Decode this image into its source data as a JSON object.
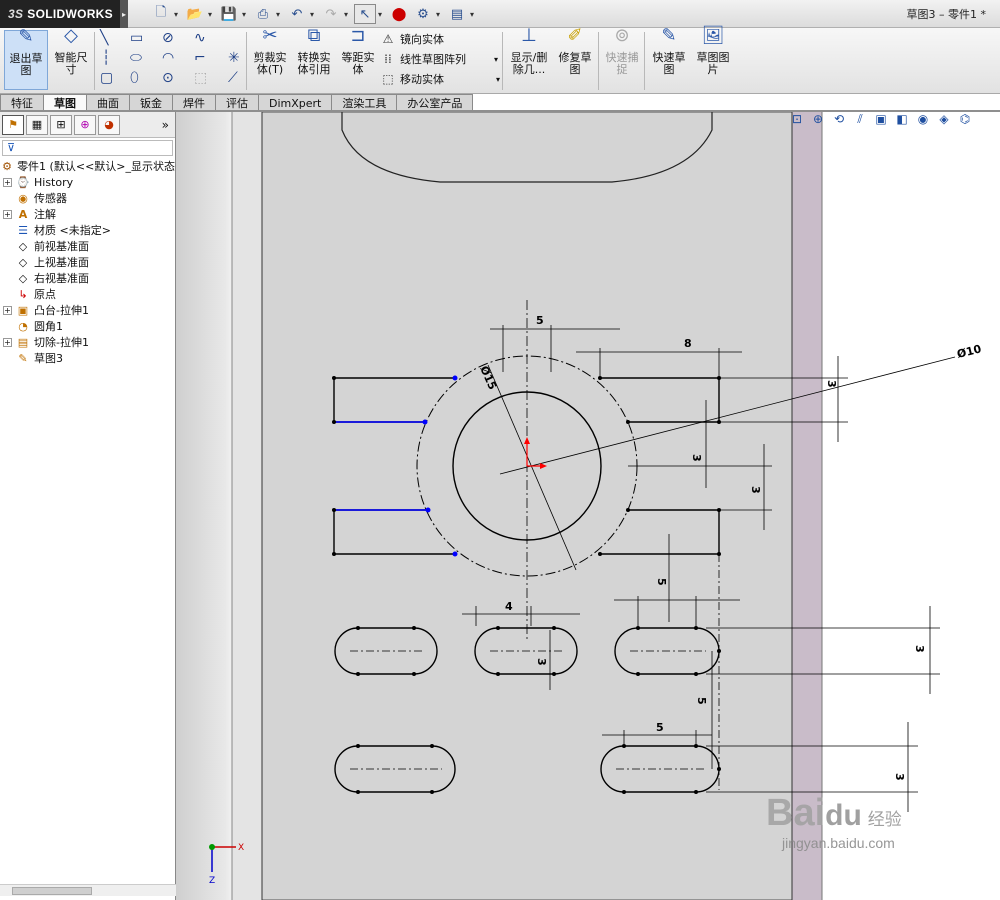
{
  "app": {
    "logo_text": "SOLIDWORKS",
    "logo_prefix": "3S",
    "doc_title": "草图3 – 零件1 *"
  },
  "quick_access": [
    "new-icon",
    "open-icon",
    "save-icon",
    "print-icon",
    "undo-icon",
    "redo-icon",
    "select-icon",
    "rebuild-icon",
    "options-icon",
    "customize-icon"
  ],
  "commands": {
    "exit_sketch": "退出草\n图",
    "smart_dim": "智能尺\n寸",
    "trim": "剪裁实\n体(T)",
    "convert": "转换实\n体引用",
    "offset": "等距实\n体",
    "mirror": "镜向实体",
    "linear_pattern": "线性草图阵列",
    "move": "移动实体",
    "display_delete": "显示/删\n除几...",
    "repair": "修复草\n图",
    "quick_snap": "快速捕\n捉",
    "rapid_sketch": "快速草\n图",
    "sketch_picture": "草图图\n片"
  },
  "tabs": [
    "特征",
    "草图",
    "曲面",
    "钣金",
    "焊件",
    "评估",
    "DimXpert",
    "渲染工具",
    "办公室产品"
  ],
  "active_tab": "草图",
  "feature_tree": {
    "root": "零件1 (默认<<默认>_显示状态",
    "items": [
      {
        "label": "History",
        "icon": "history-icon",
        "expandable": true
      },
      {
        "label": "传感器",
        "icon": "sensor-icon",
        "expandable": false
      },
      {
        "label": "注解",
        "icon": "annotation-icon",
        "expandable": true
      },
      {
        "label": "材质 <未指定>",
        "icon": "material-icon",
        "expandable": false
      },
      {
        "label": "前视基准面",
        "icon": "plane-icon",
        "expandable": false
      },
      {
        "label": "上视基准面",
        "icon": "plane-icon",
        "expandable": false
      },
      {
        "label": "右视基准面",
        "icon": "plane-icon",
        "expandable": false
      },
      {
        "label": "原点",
        "icon": "origin-icon",
        "expandable": false
      },
      {
        "label": "凸台-拉伸1",
        "icon": "extrude-icon",
        "expandable": true
      },
      {
        "label": "圆角1",
        "icon": "fillet-icon",
        "expandable": false
      },
      {
        "label": "切除-拉伸1",
        "icon": "cut-extrude-icon",
        "expandable": true
      },
      {
        "label": "草图3",
        "icon": "sketch-icon",
        "expandable": false
      }
    ]
  },
  "dimensions": {
    "d5_top": "5",
    "d8": "8",
    "phi10": "Ø10",
    "phi15": "Ø15",
    "d3_a": "3",
    "d3_b": "3",
    "d3_c": "3",
    "d4": "4",
    "d5_mid": "5",
    "d3_slot": "3",
    "d3_right": "3",
    "d5_vert": "5",
    "d5_bottom": "5",
    "d3_bottom": "3"
  },
  "triad": {
    "x_label": "X",
    "z_label": "Z"
  },
  "watermark": {
    "main": "Bai",
    "paw": "du",
    "sub": "经验",
    "url": "jingyan.baidu.com"
  },
  "colors": {
    "sketch_line": "#000000",
    "selected_line": "#0000ff",
    "accent": "#2b58a8",
    "origin": "#ff0000"
  }
}
